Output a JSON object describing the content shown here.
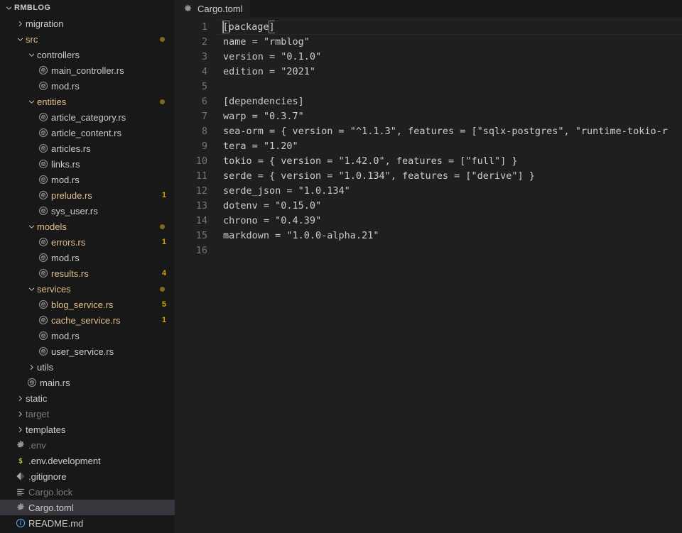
{
  "sidebar": {
    "root_label": "RMBLOG",
    "items": [
      {
        "label": "RMBLOG",
        "depth": 0,
        "type": "root",
        "state": "expanded"
      },
      {
        "label": "migration",
        "depth": 1,
        "type": "folder",
        "state": "collapsed"
      },
      {
        "label": "src",
        "depth": 1,
        "type": "folder",
        "state": "expanded",
        "modified": true
      },
      {
        "label": "controllers",
        "depth": 2,
        "type": "folder",
        "state": "expanded"
      },
      {
        "label": "main_controller.rs",
        "depth": 3,
        "type": "rust"
      },
      {
        "label": "mod.rs",
        "depth": 3,
        "type": "rust"
      },
      {
        "label": "entities",
        "depth": 2,
        "type": "folder",
        "state": "expanded",
        "modified": true
      },
      {
        "label": "article_category.rs",
        "depth": 3,
        "type": "rust"
      },
      {
        "label": "article_content.rs",
        "depth": 3,
        "type": "rust"
      },
      {
        "label": "articles.rs",
        "depth": 3,
        "type": "rust"
      },
      {
        "label": "links.rs",
        "depth": 3,
        "type": "rust"
      },
      {
        "label": "mod.rs",
        "depth": 3,
        "type": "rust"
      },
      {
        "label": "prelude.rs",
        "depth": 3,
        "type": "rust",
        "badge": "1"
      },
      {
        "label": "sys_user.rs",
        "depth": 3,
        "type": "rust"
      },
      {
        "label": "models",
        "depth": 2,
        "type": "folder",
        "state": "expanded",
        "modified": true
      },
      {
        "label": "errors.rs",
        "depth": 3,
        "type": "rust",
        "badge": "1"
      },
      {
        "label": "mod.rs",
        "depth": 3,
        "type": "rust"
      },
      {
        "label": "results.rs",
        "depth": 3,
        "type": "rust",
        "badge": "4"
      },
      {
        "label": "services",
        "depth": 2,
        "type": "folder",
        "state": "expanded",
        "modified": true
      },
      {
        "label": "blog_service.rs",
        "depth": 3,
        "type": "rust",
        "badge": "5"
      },
      {
        "label": "cache_service.rs",
        "depth": 3,
        "type": "rust",
        "badge": "1"
      },
      {
        "label": "mod.rs",
        "depth": 3,
        "type": "rust"
      },
      {
        "label": "user_service.rs",
        "depth": 3,
        "type": "rust"
      },
      {
        "label": "utils",
        "depth": 2,
        "type": "folder",
        "state": "collapsed"
      },
      {
        "label": "main.rs",
        "depth": 2,
        "type": "rust"
      },
      {
        "label": "static",
        "depth": 1,
        "type": "folder",
        "state": "collapsed"
      },
      {
        "label": "target",
        "depth": 1,
        "type": "folder",
        "state": "collapsed",
        "dim": true
      },
      {
        "label": "templates",
        "depth": 1,
        "type": "folder",
        "state": "collapsed"
      },
      {
        "label": ".env",
        "depth": 1,
        "type": "gear",
        "dim": true
      },
      {
        "label": ".env.development",
        "depth": 1,
        "type": "dollar"
      },
      {
        "label": ".gitignore",
        "depth": 1,
        "type": "git"
      },
      {
        "label": "Cargo.lock",
        "depth": 1,
        "type": "lock",
        "dim": true
      },
      {
        "label": "Cargo.toml",
        "depth": 1,
        "type": "gear",
        "selected": true
      },
      {
        "label": "README.md",
        "depth": 1,
        "type": "info"
      }
    ]
  },
  "editor": {
    "tab": {
      "label": "Cargo.toml",
      "icon": "gear-icon"
    },
    "active_line": 1,
    "lines": [
      {
        "n": "1",
        "text": "[package]",
        "bracketed": true,
        "caret": true
      },
      {
        "n": "2",
        "text": "name = \"rmblog\""
      },
      {
        "n": "3",
        "text": "version = \"0.1.0\""
      },
      {
        "n": "4",
        "text": "edition = \"2021\""
      },
      {
        "n": "5",
        "text": ""
      },
      {
        "n": "6",
        "text": "[dependencies]"
      },
      {
        "n": "7",
        "text": "warp = \"0.3.7\""
      },
      {
        "n": "8",
        "text": "sea-orm = { version = \"^1.1.3\", features = [\"sqlx-postgres\", \"runtime-tokio-r"
      },
      {
        "n": "9",
        "text": "tera = \"1.20\""
      },
      {
        "n": "10",
        "text": "tokio = { version = \"1.42.0\", features = [\"full\"] }"
      },
      {
        "n": "11",
        "text": "serde = { version = \"1.0.134\", features = [\"derive\"] }"
      },
      {
        "n": "12",
        "text": "serde_json = \"1.0.134\""
      },
      {
        "n": "13",
        "text": "dotenv = \"0.15.0\""
      },
      {
        "n": "14",
        "text": "chrono = \"0.4.39\""
      },
      {
        "n": "15",
        "text": "markdown = \"1.0.0-alpha.21\""
      },
      {
        "n": "16",
        "text": ""
      }
    ]
  },
  "colors": {
    "sidebar_bg": "#181818",
    "editor_bg": "#1f1f1f",
    "selection_bg": "#37373d",
    "modified_accent": "#e2c08d",
    "badge": "#cca700",
    "text": "#cccccc"
  }
}
